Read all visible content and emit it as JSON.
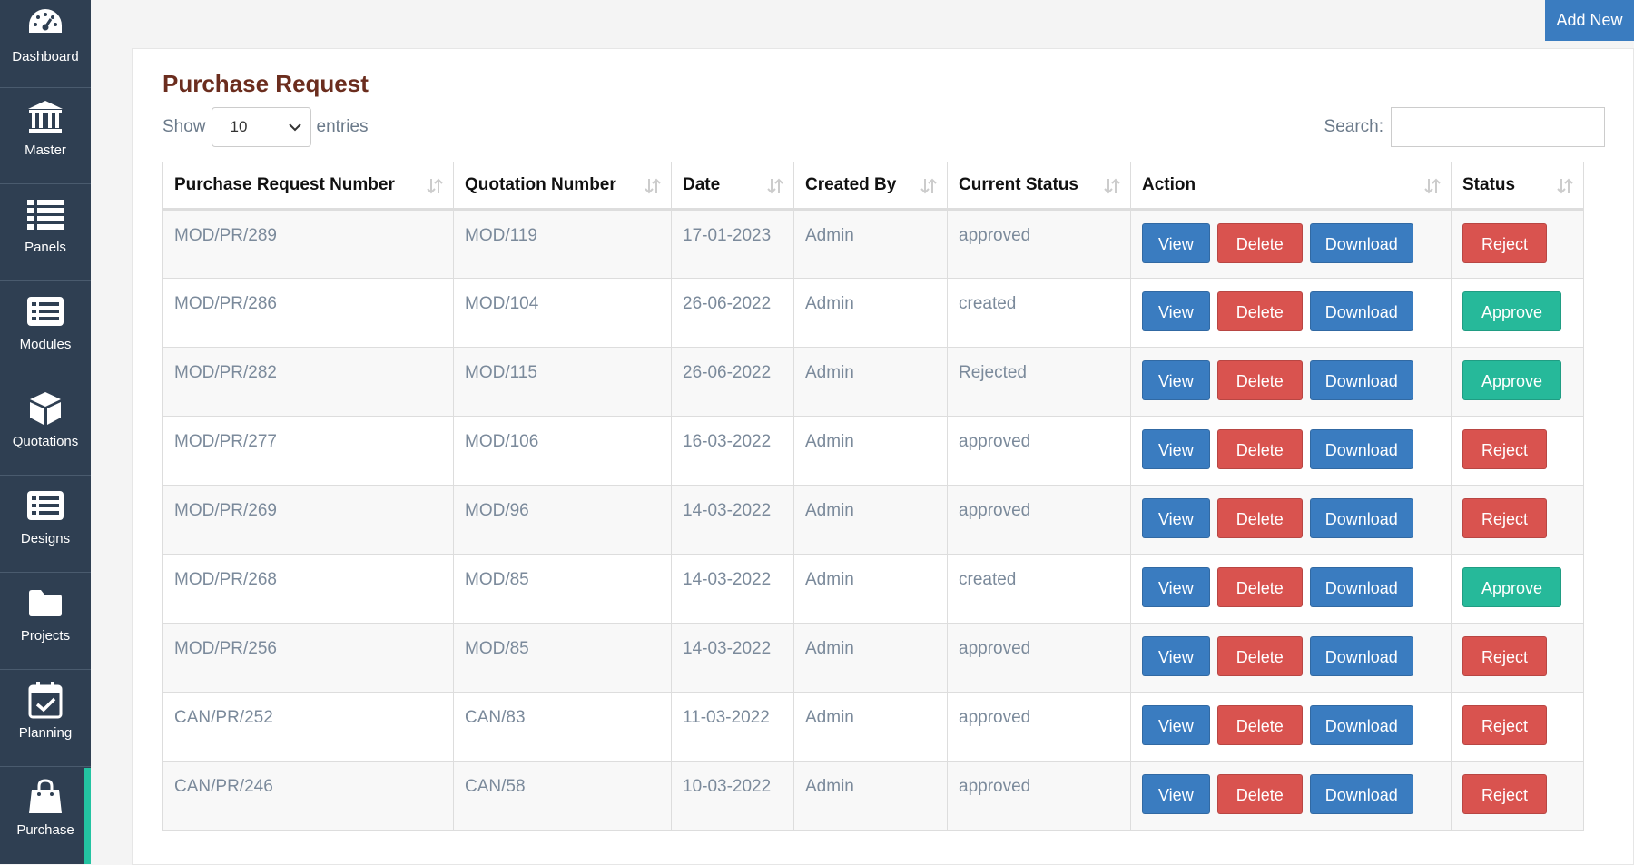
{
  "sidebar": {
    "items": [
      {
        "label": "Dashboard",
        "icon": "dashboard-icon"
      },
      {
        "label": "Master",
        "icon": "bank-icon"
      },
      {
        "label": "Panels",
        "icon": "list-icon"
      },
      {
        "label": "Modules",
        "icon": "module-list-icon"
      },
      {
        "label": "Quotations",
        "icon": "cube-icon"
      },
      {
        "label": "Designs",
        "icon": "design-list-icon"
      },
      {
        "label": "Projects",
        "icon": "folder-icon"
      },
      {
        "label": "Planning",
        "icon": "calendar-check-icon"
      },
      {
        "label": "Purchase",
        "icon": "shopping-bag-icon"
      }
    ],
    "active": "Purchase"
  },
  "header": {
    "add_new_label": "Add New"
  },
  "page": {
    "title": "Purchase Request"
  },
  "controls": {
    "show_label": "Show",
    "entries_value": "10",
    "entries_label": "entries",
    "search_label": "Search:",
    "search_value": ""
  },
  "table": {
    "columns": [
      "Purchase Request Number",
      "Quotation Number",
      "Date",
      "Created By",
      "Current Status",
      "Action",
      "Status"
    ],
    "action_labels": {
      "view": "View",
      "delete": "Delete",
      "download": "Download"
    },
    "rows": [
      {
        "pr": "MOD/PR/289",
        "quotation": "MOD/119",
        "date": "17-01-2023",
        "created_by": "Admin",
        "current_status": "approved",
        "status_action": "Reject"
      },
      {
        "pr": "MOD/PR/286",
        "quotation": "MOD/104",
        "date": "26-06-2022",
        "created_by": "Admin",
        "current_status": "created",
        "status_action": "Approve"
      },
      {
        "pr": "MOD/PR/282",
        "quotation": "MOD/115",
        "date": "26-06-2022",
        "created_by": "Admin",
        "current_status": "Rejected",
        "status_action": "Approve"
      },
      {
        "pr": "MOD/PR/277",
        "quotation": "MOD/106",
        "date": "16-03-2022",
        "created_by": "Admin",
        "current_status": "approved",
        "status_action": "Reject"
      },
      {
        "pr": "MOD/PR/269",
        "quotation": "MOD/96",
        "date": "14-03-2022",
        "created_by": "Admin",
        "current_status": "approved",
        "status_action": "Reject"
      },
      {
        "pr": "MOD/PR/268",
        "quotation": "MOD/85",
        "date": "14-03-2022",
        "created_by": "Admin",
        "current_status": "created",
        "status_action": "Approve"
      },
      {
        "pr": "MOD/PR/256",
        "quotation": "MOD/85",
        "date": "14-03-2022",
        "created_by": "Admin",
        "current_status": "approved",
        "status_action": "Reject"
      },
      {
        "pr": "CAN/PR/252",
        "quotation": "CAN/83",
        "date": "11-03-2022",
        "created_by": "Admin",
        "current_status": "approved",
        "status_action": "Reject"
      },
      {
        "pr": "CAN/PR/246",
        "quotation": "CAN/58",
        "date": "10-03-2022",
        "created_by": "Admin",
        "current_status": "approved",
        "status_action": "Reject"
      }
    ]
  },
  "colors": {
    "sidebar_bg": "#2f3f52",
    "active_accent": "#23c3a1",
    "primary": "#3a7cc0",
    "danger": "#d9534f",
    "success": "#26b99a",
    "title": "#6b2d1e"
  }
}
